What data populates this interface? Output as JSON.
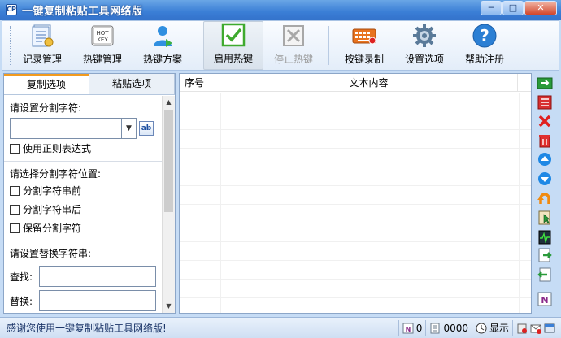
{
  "window": {
    "title": "一键复制粘贴工具网络版",
    "app_icon_text": "CP",
    "minimize": "─",
    "maximize": "□",
    "close": "✕"
  },
  "toolbar": {
    "buttons": [
      {
        "label": "记录管理",
        "icon": "records-icon"
      },
      {
        "label": "热键管理",
        "icon": "hotkey-icon",
        "icon_text": "HOT KEY"
      },
      {
        "label": "热键方案",
        "icon": "user-scheme-icon"
      },
      {
        "label": "启用热键",
        "icon": "enable-hotkey-icon"
      },
      {
        "label": "停止热键",
        "icon": "stop-hotkey-icon"
      },
      {
        "label": "按键录制",
        "icon": "keyboard-record-icon"
      },
      {
        "label": "设置选项",
        "icon": "settings-gear-icon"
      },
      {
        "label": "帮助注册",
        "icon": "help-icon",
        "icon_text": "?"
      }
    ]
  },
  "left_panel": {
    "tabs": [
      "复制选项",
      "粘贴选项"
    ],
    "split_label": "请设置分割字符:",
    "split_value": "",
    "regex_label": "使用正则表达式",
    "regex_icon_text": "ab",
    "position_label": "请选择分割字符位置:",
    "positions": [
      "分割字符串前",
      "分割字符串后",
      "保留分割字符"
    ],
    "replace_label": "请设置替换字符串:",
    "find_label": "查找:",
    "replace_with_label": "替换:",
    "find_value": "",
    "replace_value": ""
  },
  "list": {
    "columns": [
      "序号",
      "文本内容"
    ],
    "rows": []
  },
  "status": {
    "message": "感谢您使用一键复制粘贴工具网络版!",
    "count_a": "0",
    "count_b": "0000",
    "show_label": "显示"
  },
  "colors": {
    "title_bar": "#3b7fd6",
    "accent_tab": "#f29b1f",
    "status_text": "#1b3568"
  }
}
